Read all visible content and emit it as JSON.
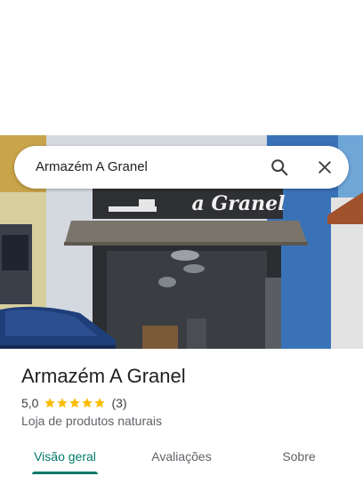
{
  "search": {
    "query": "Armazém A Granel",
    "search_icon": "search-icon",
    "close_icon": "close-icon"
  },
  "photo": {
    "storefront_sign_text": "a Granel"
  },
  "place": {
    "name": "Armazém A Granel",
    "rating": "5,0",
    "stars": 5,
    "review_count": "(3)",
    "category": "Loja de produtos naturais"
  },
  "tabs": [
    {
      "label": "Visão geral",
      "active": true
    },
    {
      "label": "Avaliações",
      "active": false
    },
    {
      "label": "Sobre",
      "active": false
    }
  ],
  "colors": {
    "accent": "#00796b",
    "star": "#fbbc04",
    "text_primary": "#202124",
    "text_secondary": "#5f6368"
  }
}
